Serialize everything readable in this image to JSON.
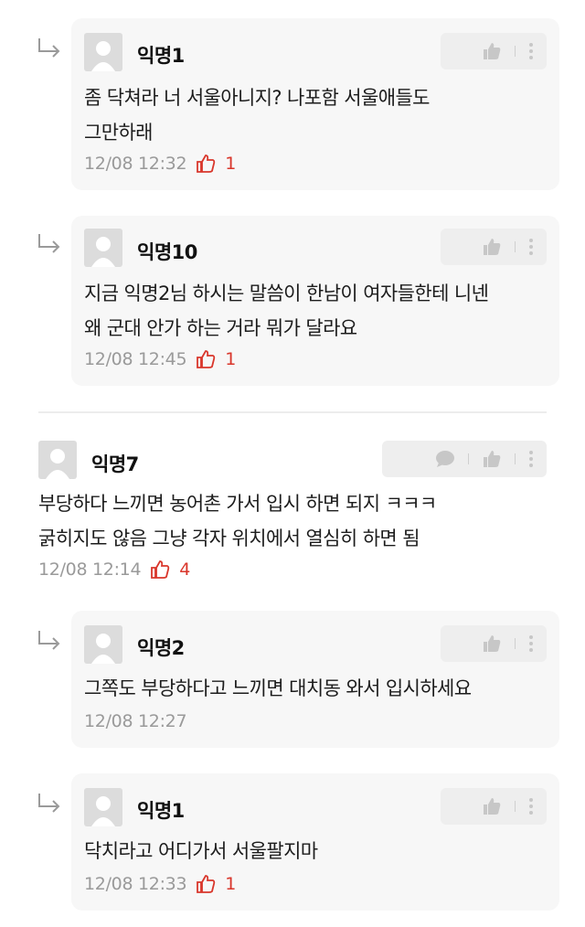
{
  "comments": [
    {
      "author": "익명1",
      "line1": "좀 닥쳐라 너 서울아니지? 나포함 서울애들도",
      "line2": "그만하래",
      "time": "12/08 12:32",
      "likes": "1"
    },
    {
      "author": "익명10",
      "line1": "지금 익명2님 하시는 말씀이 한남이 여자들한테 니넨",
      "line2": "왜 군대 안가 하는 거라 뭐가 달라요",
      "time": "12/08 12:45",
      "likes": "1"
    },
    {
      "author": "익명7",
      "line1": "부당하다 느끼면 농어촌 가서 입시 하면 되지 ㅋㅋㅋ",
      "line2": "굵히지도 않음 그냥 각자 위치에서 열심히 하면 됨",
      "time": "12/08 12:14",
      "likes": "4"
    },
    {
      "author": "익명2",
      "line1": "그쪽도 부당하다고 느끼면 대치동 와서 입시하세요",
      "time": "12/08 12:27"
    },
    {
      "author": "익명1",
      "line1": "닥치라고 어디가서 서울팔지마",
      "time": "12/08 12:33",
      "likes": "1"
    }
  ],
  "colors": {
    "like": "#d9362b",
    "meta": "#9a9a9a",
    "card": "#f7f7f7"
  },
  "icons": [
    "reply-arrow-icon",
    "thumbs-up-icon",
    "more-vertical-icon",
    "speech-bubble-icon",
    "anonymous-avatar-icon",
    "heart-outline-icon"
  ]
}
